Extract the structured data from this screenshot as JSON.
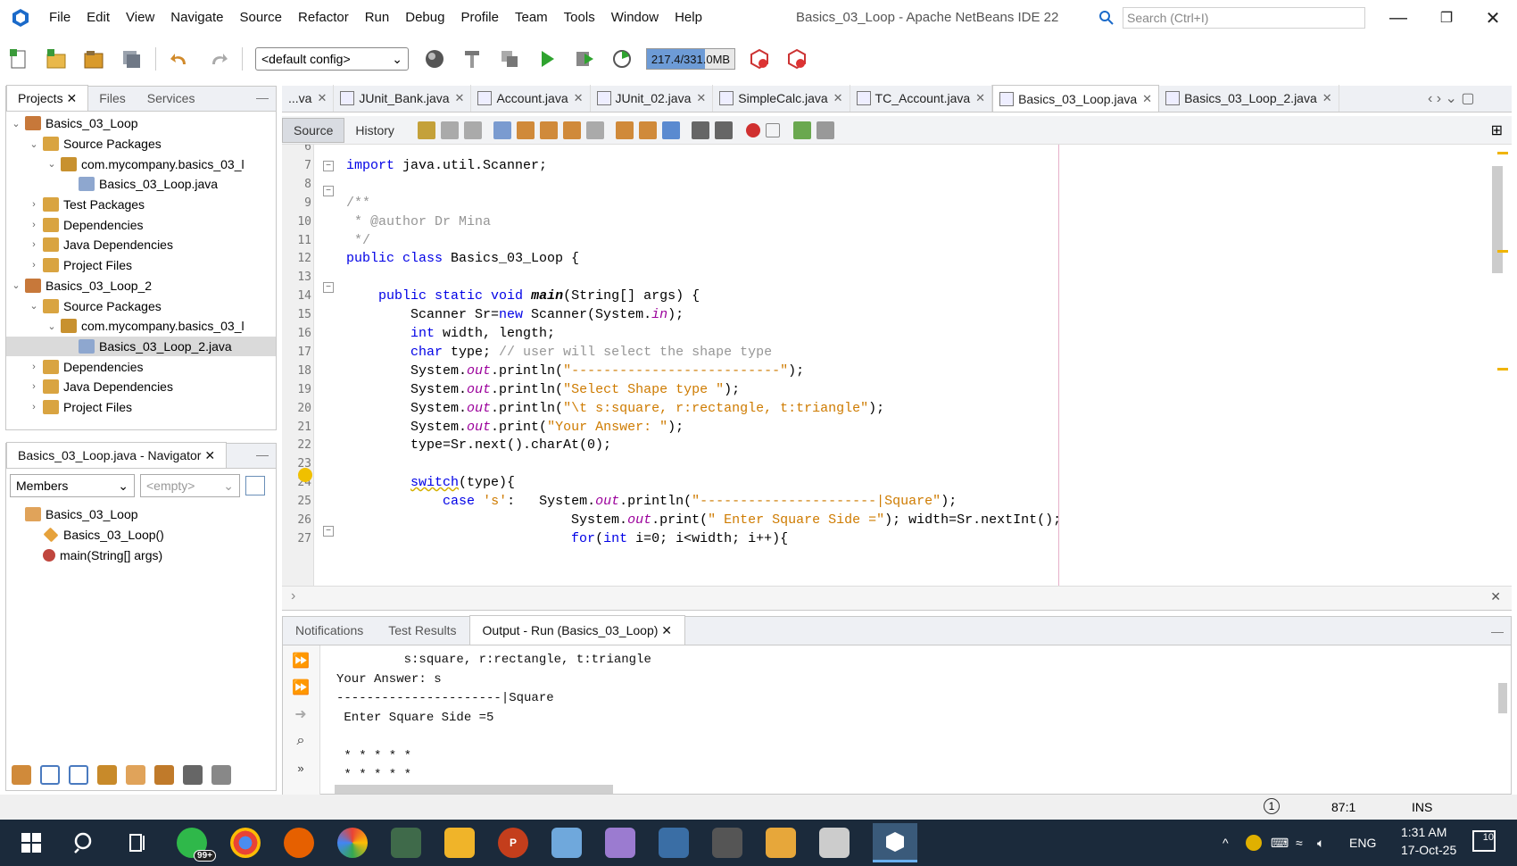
{
  "window": {
    "title": "Basics_03_Loop - Apache NetBeans IDE 22",
    "search_placeholder": "Search (Ctrl+I)",
    "minimize": "—",
    "restore": "❐",
    "close": "✕"
  },
  "menu": [
    "File",
    "Edit",
    "View",
    "Navigate",
    "Source",
    "Refactor",
    "Run",
    "Debug",
    "Profile",
    "Team",
    "Tools",
    "Window",
    "Help"
  ],
  "toolbar": {
    "config": "<default config>",
    "memory_label": "217.4/331.0MB",
    "memory_fraction": 0.66
  },
  "projects_panel": {
    "tabs": [
      "Projects",
      "Files",
      "Services"
    ],
    "tree": [
      {
        "label": "Basics_03_Loop",
        "depth": 0,
        "expanded": true,
        "kind": "project"
      },
      {
        "label": "Source Packages",
        "depth": 1,
        "expanded": true,
        "kind": "folder"
      },
      {
        "label": "com.mycompany.basics_03_l",
        "depth": 2,
        "expanded": true,
        "kind": "package"
      },
      {
        "label": "Basics_03_Loop.java",
        "depth": 3,
        "kind": "java"
      },
      {
        "label": "Test Packages",
        "depth": 1,
        "expanded": false,
        "kind": "folder"
      },
      {
        "label": "Dependencies",
        "depth": 1,
        "expanded": false,
        "kind": "folder"
      },
      {
        "label": "Java Dependencies",
        "depth": 1,
        "expanded": false,
        "kind": "folder"
      },
      {
        "label": "Project Files",
        "depth": 1,
        "expanded": false,
        "kind": "folder"
      },
      {
        "label": "Basics_03_Loop_2",
        "depth": 0,
        "expanded": true,
        "kind": "project"
      },
      {
        "label": "Source Packages",
        "depth": 1,
        "expanded": true,
        "kind": "folder"
      },
      {
        "label": "com.mycompany.basics_03_l",
        "depth": 2,
        "expanded": true,
        "kind": "package"
      },
      {
        "label": "Basics_03_Loop_2.java",
        "depth": 3,
        "kind": "java",
        "selected": true
      },
      {
        "label": "Dependencies",
        "depth": 1,
        "expanded": false,
        "kind": "folder"
      },
      {
        "label": "Java Dependencies",
        "depth": 1,
        "expanded": false,
        "kind": "folder"
      },
      {
        "label": "Project Files",
        "depth": 1,
        "expanded": false,
        "kind": "folder"
      }
    ]
  },
  "navigator": {
    "title": "Basics_03_Loop.java - Navigator",
    "filter": "Members",
    "filter2": "<empty>",
    "items": [
      {
        "label": "Basics_03_Loop",
        "depth": 0,
        "kind": "class"
      },
      {
        "label": "Basics_03_Loop()",
        "depth": 1,
        "kind": "ctor"
      },
      {
        "label": "main(String[] args)",
        "depth": 1,
        "kind": "method"
      }
    ]
  },
  "editor": {
    "tabs": [
      {
        "label": "...va",
        "active": false
      },
      {
        "label": "JUnit_Bank.java",
        "active": false
      },
      {
        "label": "Account.java",
        "active": false
      },
      {
        "label": "JUnit_02.java",
        "active": false
      },
      {
        "label": "SimpleCalc.java",
        "active": false
      },
      {
        "label": "TC_Account.java",
        "active": false
      },
      {
        "label": "Basics_03_Loop.java",
        "active": true
      },
      {
        "label": "Basics_03_Loop_2.java",
        "active": false
      }
    ],
    "mode_tabs": [
      "Source",
      "History"
    ],
    "line_numbers": [
      "6",
      "7",
      "8",
      "9",
      "10",
      "11",
      "12",
      "13",
      "14",
      "15",
      "16",
      "17",
      "18",
      "19",
      "20",
      "21",
      "22",
      "23",
      "24",
      "25",
      "26",
      "27"
    ]
  },
  "output": {
    "tabs": [
      "Notifications",
      "Test Results",
      "Output - Run (Basics_03_Loop)"
    ],
    "lines": [
      "         s:square, r:rectangle, t:triangle",
      "Your Answer: s",
      "----------------------|Square",
      " Enter Square Side =5",
      "",
      " * * * * *",
      " * * * * *"
    ]
  },
  "status": {
    "position": "87:1",
    "mode": "INS"
  },
  "taskbar": {
    "badge": "99+",
    "language": "ENG",
    "time": "1:31 AM",
    "date": "17-Oct-25",
    "notif_count": "10"
  }
}
